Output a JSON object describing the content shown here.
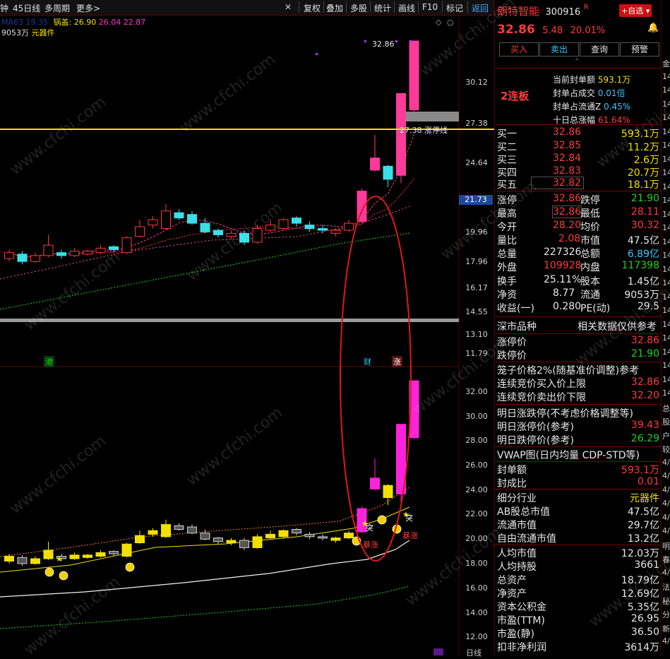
{
  "toolbar": {
    "left_items": [
      "钟",
      "45日线",
      "多周期",
      "更多>"
    ],
    "right_items": [
      "复权",
      "叠加",
      "多股",
      "统计",
      "画线",
      "F10",
      "标记",
      "返回"
    ]
  },
  "indicator_header": {
    "ma_label": "MA63",
    "ma_value": "19.35",
    "pot_label": "锅盖:",
    "pot_values": [
      "26.90",
      "26.04",
      "22.87"
    ],
    "float_cap": "9053万",
    "industry": "元器件"
  },
  "price_axis": {
    "labels": [
      "30.12",
      "27.38",
      "24.64",
      "21.73",
      "19.96",
      "17.96",
      "16.17",
      "14.55",
      "13.10",
      "11.79"
    ],
    "highlight": "21.73"
  },
  "lower_axis": {
    "labels": [
      "32.00",
      "30.00",
      "28.00",
      "26.00",
      "24.00",
      "22.00",
      "20.00",
      "18.00",
      "16.00",
      "14.00",
      "12.00"
    ]
  },
  "chart_annotations": {
    "high_label": "32.86",
    "limit_line_label": "27.38 涨停线",
    "tags": [
      "港",
      "财",
      "涨"
    ],
    "breakout": "突",
    "surge": "暴涨",
    "bottom_label": "日线"
  },
  "chart_data": {
    "type": "candlestick",
    "ylim": [
      11.79,
      32.86
    ],
    "candles": [
      {
        "o": 18.1,
        "c": 18.5,
        "h": 18.7,
        "l": 17.9
      },
      {
        "o": 18.4,
        "c": 17.9,
        "h": 18.6,
        "l": 17.7
      },
      {
        "o": 17.9,
        "c": 18.3,
        "h": 18.5,
        "l": 17.8
      },
      {
        "o": 18.3,
        "c": 19.0,
        "h": 19.7,
        "l": 18.2
      },
      {
        "o": 18.5,
        "c": 18.3,
        "h": 18.7,
        "l": 18.1
      },
      {
        "o": 18.3,
        "c": 18.6,
        "h": 18.8,
        "l": 18.2
      },
      {
        "o": 18.4,
        "c": 18.6,
        "h": 18.7,
        "l": 18.3
      },
      {
        "o": 18.5,
        "c": 18.8,
        "h": 19.0,
        "l": 18.4
      },
      {
        "o": 18.9,
        "c": 18.7,
        "h": 19.0,
        "l": 18.5
      },
      {
        "o": 18.5,
        "c": 19.5,
        "h": 19.6,
        "l": 18.4
      },
      {
        "o": 19.6,
        "c": 20.2,
        "h": 20.6,
        "l": 19.5
      },
      {
        "o": 20.3,
        "c": 20.6,
        "h": 20.8,
        "l": 20.1
      },
      {
        "o": 20.1,
        "c": 21.1,
        "h": 21.5,
        "l": 20.0
      },
      {
        "o": 21.0,
        "c": 20.7,
        "h": 21.2,
        "l": 20.6
      },
      {
        "o": 20.9,
        "c": 20.4,
        "h": 21.1,
        "l": 20.3
      },
      {
        "o": 20.4,
        "c": 19.9,
        "h": 20.7,
        "l": 19.8
      },
      {
        "o": 20.0,
        "c": 19.7,
        "h": 20.1,
        "l": 19.5
      },
      {
        "o": 19.6,
        "c": 19.8,
        "h": 20.0,
        "l": 19.4
      },
      {
        "o": 19.8,
        "c": 19.2,
        "h": 20.0,
        "l": 19.0
      },
      {
        "o": 19.2,
        "c": 20.1,
        "h": 20.3,
        "l": 19.1
      },
      {
        "o": 20.0,
        "c": 20.3,
        "h": 20.6,
        "l": 19.9
      },
      {
        "o": 20.1,
        "c": 20.6,
        "h": 20.7,
        "l": 20.0
      },
      {
        "o": 20.7,
        "c": 20.4,
        "h": 20.8,
        "l": 20.2
      },
      {
        "o": 20.3,
        "c": 20.1,
        "h": 20.5,
        "l": 19.9
      },
      {
        "o": 20.1,
        "c": 20.0,
        "h": 20.3,
        "l": 19.8
      },
      {
        "o": 19.8,
        "c": 20.0,
        "h": 20.1,
        "l": 19.6
      },
      {
        "o": 20.0,
        "c": 20.4,
        "h": 20.6,
        "l": 19.9
      },
      {
        "o": 20.5,
        "c": 22.4,
        "h": 22.6,
        "l": 20.4
      },
      {
        "o": 24.0,
        "c": 24.9,
        "h": 26.5,
        "l": 23.9
      },
      {
        "o": 24.3,
        "c": 23.3,
        "h": 24.4,
        "l": 22.7
      },
      {
        "o": 23.6,
        "c": 29.3,
        "h": 29.3,
        "l": 23.0
      },
      {
        "o": 28.2,
        "c": 32.86,
        "h": 32.86,
        "l": 28.11
      }
    ],
    "limit_up": 27.38,
    "lower_panel_ylim": [
      12.0,
      32.0
    ]
  },
  "stock": {
    "name": "朗特智能",
    "code": "300916",
    "flag": "R",
    "add_button": "+自选",
    "price": "32.86",
    "change": "5.48",
    "change_pct": "20.01%"
  },
  "actions": [
    "买入",
    "卖出",
    "查询",
    "预警"
  ],
  "seal": {
    "board": "2连板",
    "lines": [
      {
        "label": "当前封单额",
        "value": "593.1万"
      },
      {
        "label": "封单占成交",
        "value": "0.01倍"
      },
      {
        "label": "封单占流通Z",
        "value": "0.45%"
      },
      {
        "label": "十日总涨幅",
        "value": "61.64%"
      }
    ]
  },
  "orderbook": [
    {
      "label": "买一",
      "price": "32.86",
      "vol": "593.1万"
    },
    {
      "label": "买二",
      "price": "32.85",
      "vol": "11.2万"
    },
    {
      "label": "买三",
      "price": "32.84",
      "vol": "2.6万"
    },
    {
      "label": "买四",
      "price": "32.83",
      "vol": "20.7万"
    },
    {
      "label": "买五",
      "price": "32.82",
      "vol": "18.1万"
    }
  ],
  "stats": [
    {
      "l1": "涨停",
      "v1": "32.86",
      "l2": "跌停",
      "v2": "21.90"
    },
    {
      "l1": "最高",
      "v1": "32.86",
      "l2": "最低",
      "v2": "28.11"
    },
    {
      "l1": "今开",
      "v1": "28.20",
      "l2": "均价",
      "v2": "30.32"
    },
    {
      "l1": "量比",
      "v1": "2.08",
      "l2": "市值",
      "v2": "47.5亿"
    },
    {
      "l1": "总量",
      "v1": "227326",
      "l2": "总额",
      "v2": "6.89亿"
    },
    {
      "l1": "外盘",
      "v1": "109928",
      "l2": "内盘",
      "v2": "117398"
    },
    {
      "l1": "换手",
      "v1": "25.11%",
      "l2": "股本",
      "v2": "1.45亿"
    },
    {
      "l1": "净资",
      "v1": "8.77",
      "l2": "流通",
      "v2": "9053万"
    },
    {
      "l1": "收益(一)",
      "v1": "0.280",
      "l2": "PE(动)",
      "v2": "29.5"
    }
  ],
  "market": {
    "name": "深市品种",
    "note": "相关数据仅供参考"
  },
  "limits": [
    {
      "label": "涨停价",
      "value": "32.86"
    },
    {
      "label": "跌停价",
      "value": "21.90"
    }
  ],
  "cage": {
    "title": "笼子价格2%(随基准价调整)参考",
    "up_label": "连续竞价买入价上限",
    "up_value": "32.86",
    "down_label": "连续竞价卖出价下限",
    "down_value": "32.20"
  },
  "tomorrow": {
    "title": "明日涨跌停(不考虑价格调整等)",
    "up_label": "明日涨停价(参考)",
    "up_value": "39.43",
    "down_label": "明日跌停价(参考)",
    "down_value": "26.29"
  },
  "vwap_title": "VWAP图(日内均量 CDP-STD等)",
  "details": [
    {
      "label": "封单额",
      "value": "593.1万"
    },
    {
      "label": "封成比",
      "value": "0.01"
    },
    {
      "label": "细分行业",
      "value": "元器件"
    },
    {
      "label": "AB股总市值",
      "value": "47.5亿"
    },
    {
      "label": "流通市值",
      "value": "29.7亿"
    },
    {
      "label": "自由流通市值",
      "value": "13.2亿"
    },
    {
      "label": "人均市值",
      "value": "12.03万"
    },
    {
      "label": "人均持股",
      "value": "3661"
    },
    {
      "label": "总资产",
      "value": "18.79亿"
    },
    {
      "label": "净资产",
      "value": "12.69亿"
    },
    {
      "label": "资本公积金",
      "value": "5.35亿"
    },
    {
      "label": "市盈(TTM)",
      "value": "26.95"
    },
    {
      "label": "市盈(静)",
      "value": "36.50"
    },
    {
      "label": "扣非净利润",
      "value": "3614万"
    }
  ],
  "watermark": "www.cfchi.com",
  "colors": {
    "up": "#ff3a3a",
    "down": "#1fd21f",
    "accent": "#f0e000",
    "highlight": "#ff33cc"
  }
}
